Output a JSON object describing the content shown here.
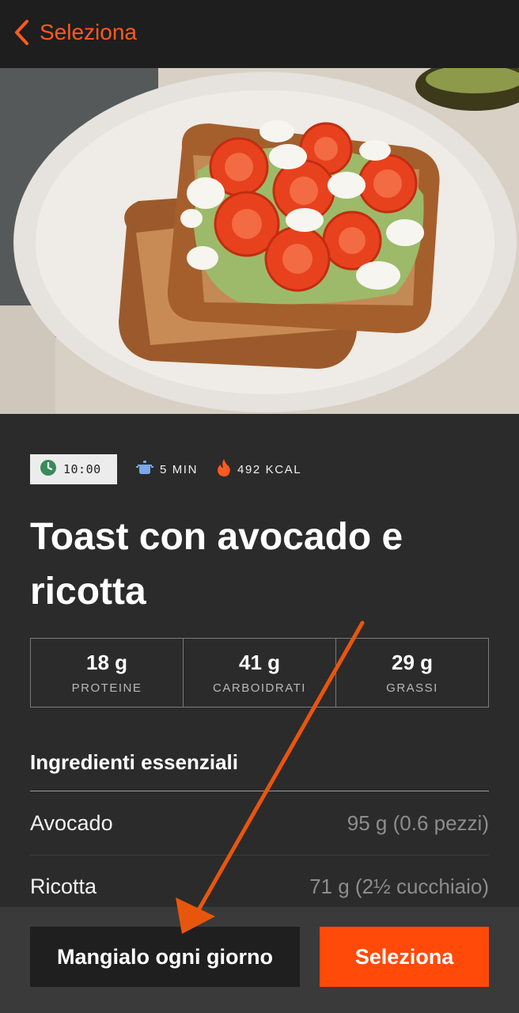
{
  "header": {
    "back_label": "Seleziona",
    "icon": "chevron-left-icon",
    "accent_color": "#ff5a1f"
  },
  "hero": {
    "image": "avocado-toast-photo"
  },
  "meta": {
    "time": "10:00",
    "duration": "5 MIN",
    "calories": "492 KCAL",
    "time_icon": "clock-icon",
    "duration_icon": "pot-icon",
    "calories_icon": "flame-icon"
  },
  "recipe": {
    "title": "Toast con avocado e ricotta"
  },
  "macros": [
    {
      "value": "18 g",
      "label": "PROTEINE"
    },
    {
      "value": "41 g",
      "label": "CARBOIDRATI"
    },
    {
      "value": "29 g",
      "label": "GRASSI"
    }
  ],
  "ingredients": {
    "heading": "Ingredienti essenziali",
    "items": [
      {
        "name": "Avocado",
        "qty": "95 g (0.6 pezzi)"
      },
      {
        "name": "Ricotta",
        "qty": "71 g (2½ cucchiaio)"
      }
    ]
  },
  "actions": {
    "daily_label": "Mangialo ogni giorno",
    "select_label": "Seleziona",
    "primary_color": "#ff4a0a"
  },
  "annotation": {
    "color": "#e8560e"
  }
}
